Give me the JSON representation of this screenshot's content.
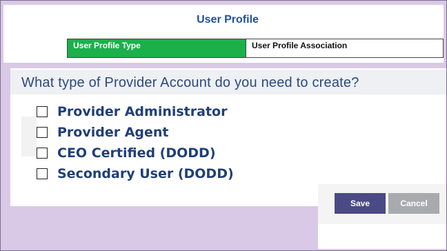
{
  "header": {
    "title": "User Profile"
  },
  "tabs": [
    {
      "label": "User Profile Type",
      "active": true
    },
    {
      "label": "User Profile Association",
      "active": false
    }
  ],
  "question": "What type of Provider Account do you need to create?",
  "options": [
    {
      "label": "Provider Administrator",
      "checked": false
    },
    {
      "label": "Provider Agent",
      "checked": false
    },
    {
      "label": "CEO Certified (DODD)",
      "checked": false
    },
    {
      "label": "Secondary User (DODD)",
      "checked": false
    }
  ],
  "buttons": {
    "save": "Save",
    "cancel": "Cancel"
  },
  "colors": {
    "background": "#d9c9e6",
    "active_tab": "#1bb04a",
    "title_text": "#1f4f9c",
    "option_text": "#1f3f78",
    "save_button": "#4a4a86",
    "cancel_button": "#a9aaad"
  }
}
